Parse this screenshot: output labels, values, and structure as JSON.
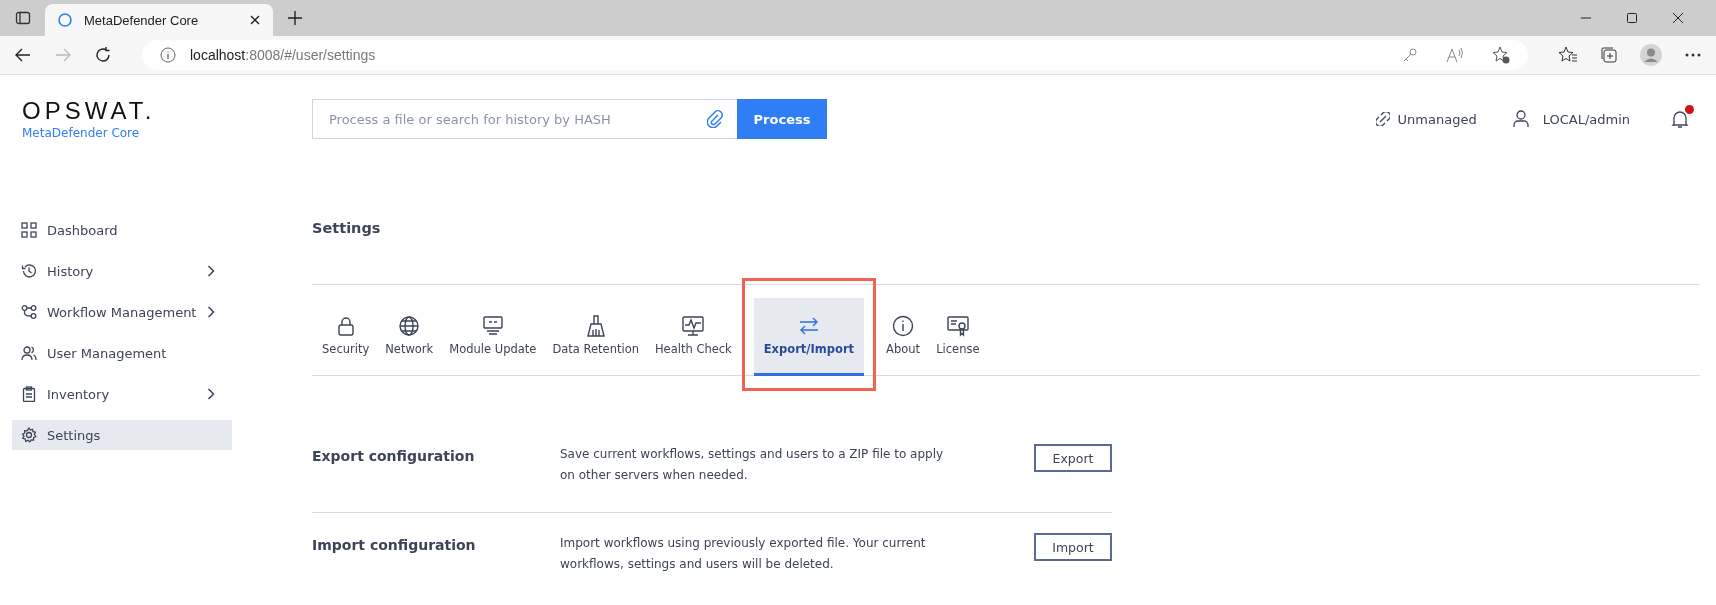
{
  "browser": {
    "tab_title": "MetaDefender Core",
    "url_host": "localhost",
    "url_path": ":8008/#/user/settings"
  },
  "header": {
    "logo": "OPSWAT.",
    "product": "MetaDefender Core",
    "search": {
      "placeholder": "Process a file or search for history by HASH"
    },
    "process_button": "Process",
    "unmanaged": "Unmanaged",
    "user": "LOCAL/admin",
    "notification": true
  },
  "sidebar": {
    "items": [
      {
        "label": "Dashboard",
        "has_submenu": false,
        "selected": false
      },
      {
        "label": "History",
        "has_submenu": true,
        "selected": false
      },
      {
        "label": "Workflow Management",
        "has_submenu": true,
        "selected": false
      },
      {
        "label": "User Management",
        "has_submenu": false,
        "selected": false
      },
      {
        "label": "Inventory",
        "has_submenu": true,
        "selected": false
      },
      {
        "label": "Settings",
        "has_submenu": false,
        "selected": true
      }
    ]
  },
  "page_title": "Settings",
  "tabs": [
    {
      "label": "Security",
      "selected": false,
      "highlighted": false
    },
    {
      "label": "Network",
      "selected": false,
      "highlighted": false
    },
    {
      "label": "Module Update",
      "selected": false,
      "highlighted": false
    },
    {
      "label": "Data Retention",
      "selected": false,
      "highlighted": false
    },
    {
      "label": "Health Check",
      "selected": false,
      "highlighted": false
    },
    {
      "label": "Export/Import",
      "selected": true,
      "highlighted": true
    },
    {
      "label": "About",
      "selected": false,
      "highlighted": false
    },
    {
      "label": "License",
      "selected": false,
      "highlighted": false
    }
  ],
  "sections": [
    {
      "title": "Export configuration",
      "description": "Save current workflows, settings and users to a ZIP file to apply on other servers when needed.",
      "button": "Export"
    },
    {
      "title": "Import configuration",
      "description": "Import workflows using previously exported file. Your current workflows, settings and users will be deleted.",
      "button": "Import"
    }
  ]
}
